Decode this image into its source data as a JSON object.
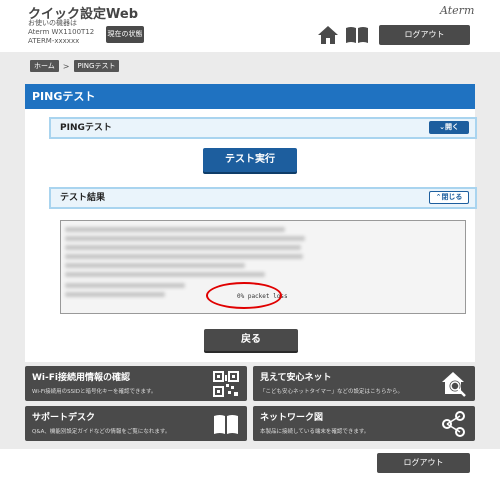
{
  "header": {
    "app_title": "クイック設定Web",
    "device_line1": "お使いの機器は",
    "device_line2": "Aterm WX1100T12",
    "device_line3": "ATERM-xxxxxx",
    "status_button": "現在の状態",
    "brand": "Aterm",
    "logout": "ログアウト"
  },
  "breadcrumb": {
    "home": "ホーム",
    "separator": ">",
    "current": "PINGテスト"
  },
  "page": {
    "title": "PINGテスト",
    "ping_section": {
      "label": "PINGテスト",
      "toggle": "開く"
    },
    "run_button": "テスト実行",
    "result_section": {
      "label": "テスト結果",
      "toggle": "閉じる"
    },
    "result_text": "0% packet loss",
    "back_button": "戻る"
  },
  "tiles": [
    {
      "title": "Wi-Fi接続用情報の確認",
      "desc": "Wi-Fi接続用のSSIDと暗号化キーを確認できます。",
      "icon": "qr-code-icon"
    },
    {
      "title": "見えて安心ネット",
      "desc": "「こども安心ネットタイマー」などの設定はこちらから。",
      "icon": "home-search-icon"
    },
    {
      "title": "サポートデスク",
      "desc": "Q&A、機能別設定ガイドなどの情報をご覧になれます。",
      "icon": "book-icon"
    },
    {
      "title": "ネットワーク図",
      "desc": "本製品に接続している端末を確認できます。",
      "icon": "network-icon"
    }
  ],
  "footer": {
    "logout": "ログアウト"
  },
  "colors": {
    "accent_blue": "#1f72c1",
    "dark_button": "#4a4a4a",
    "highlight_red": "#e00000"
  }
}
